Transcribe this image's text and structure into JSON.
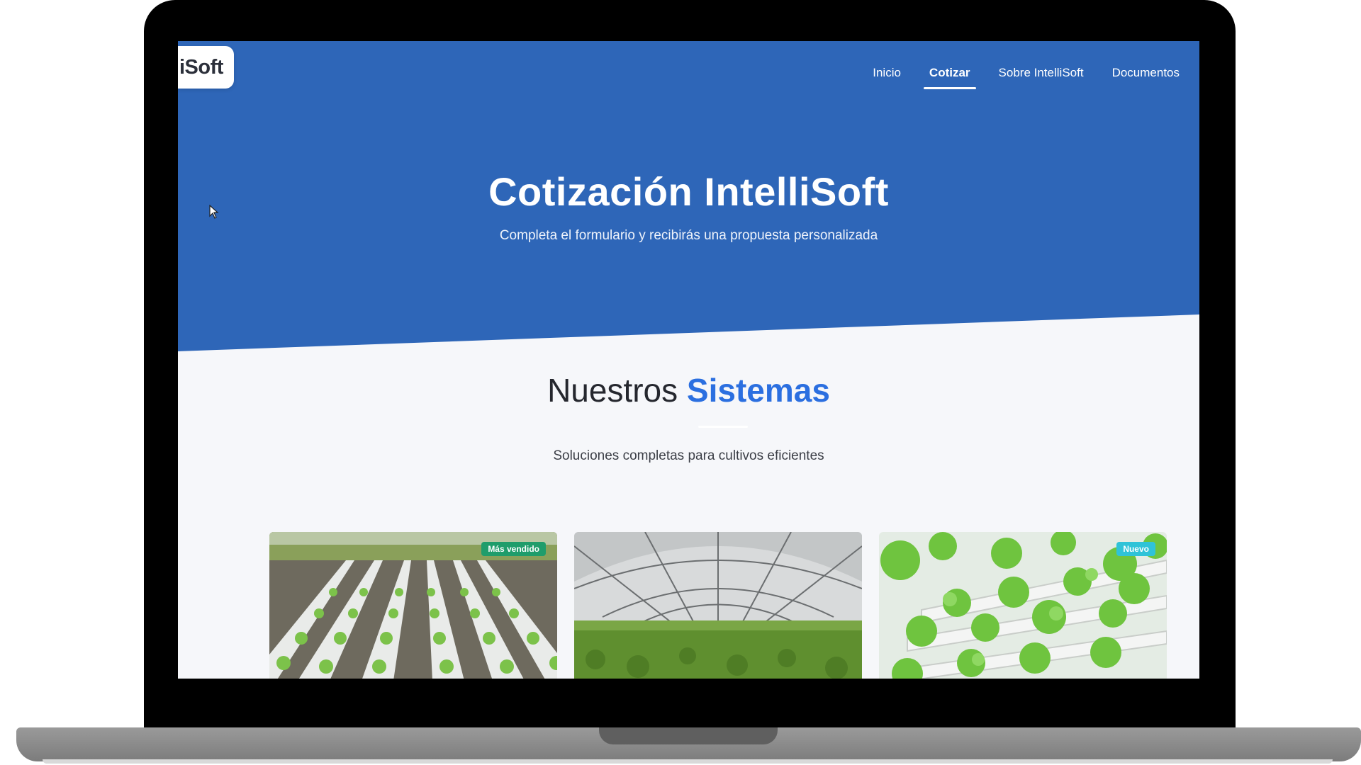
{
  "brand": {
    "logo_text": "iSoft"
  },
  "nav": {
    "items": [
      {
        "label": "Inicio",
        "active": false
      },
      {
        "label": "Cotizar",
        "active": true
      },
      {
        "label": "Sobre IntelliSoft",
        "active": false
      },
      {
        "label": "Documentos",
        "active": false
      }
    ]
  },
  "hero": {
    "title": "Cotización IntelliSoft",
    "subtitle": "Completa el formulario y recibirás una propuesta personalizada",
    "background_color": "#2e66b8"
  },
  "section": {
    "title_plain": "Nuestros",
    "title_accent": "Sistemas",
    "subtitle": "Soluciones completas para cultivos eficientes",
    "accent_color": "#2b6fe0"
  },
  "cards": [
    {
      "badge": "Más vendido",
      "badge_color": "#1f9d6b",
      "image_icon": "hydroponic-rows-image"
    },
    {
      "badge": "",
      "badge_color": "",
      "image_icon": "greenhouse-image"
    },
    {
      "badge": "Nuevo",
      "badge_color": "#2fc3d8",
      "image_icon": "vertical-farm-image"
    }
  ]
}
